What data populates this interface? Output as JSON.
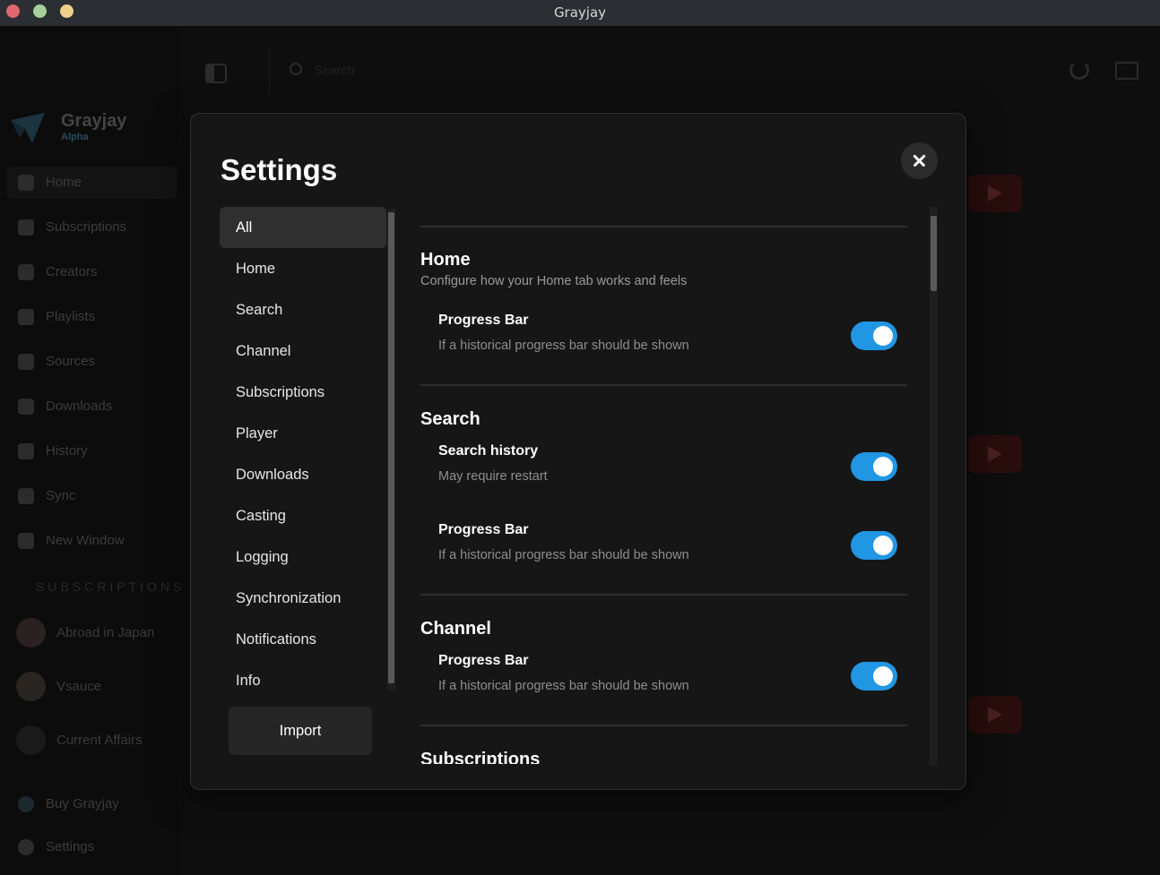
{
  "window": {
    "title": "Grayjay"
  },
  "background": {
    "brand": {
      "name": "Grayjay",
      "tag": "Alpha"
    },
    "search_placeholder": "Search",
    "sidebar": {
      "items": [
        {
          "label": "Home",
          "icon": "home-icon"
        },
        {
          "label": "Subscriptions",
          "icon": "subscriptions-icon"
        },
        {
          "label": "Creators",
          "icon": "creators-icon"
        },
        {
          "label": "Playlists",
          "icon": "playlists-icon"
        },
        {
          "label": "Sources",
          "icon": "sources-icon"
        },
        {
          "label": "Downloads",
          "icon": "downloads-icon"
        },
        {
          "label": "History",
          "icon": "history-icon"
        },
        {
          "label": "Sync",
          "icon": "sync-icon"
        },
        {
          "label": "New Window",
          "icon": "new-window-icon"
        }
      ],
      "subscriptions_heading": "SUBSCRIPTIONS",
      "subscriptions": [
        "Abroad in Japan",
        "Vsauce",
        "Current Affairs"
      ],
      "bottom": [
        {
          "label": "Buy Grayjay",
          "icon": "dollar-icon"
        },
        {
          "label": "Settings",
          "icon": "gear-icon"
        }
      ]
    }
  },
  "settings": {
    "title": "Settings",
    "nav": [
      "All",
      "Home",
      "Search",
      "Channel",
      "Subscriptions",
      "Player",
      "Downloads",
      "Casting",
      "Logging",
      "Synchronization",
      "Notifications",
      "Info"
    ],
    "active_nav": "All",
    "import_label": "Import",
    "sections": [
      {
        "title": "Home",
        "description": "Configure how your Home tab works and feels",
        "settings": [
          {
            "title": "Progress Bar",
            "description": "If a historical progress bar should be shown",
            "enabled": true
          }
        ]
      },
      {
        "title": "Search",
        "settings": [
          {
            "title": "Search history",
            "description": "May require restart",
            "enabled": true
          },
          {
            "title": "Progress Bar",
            "description": "If a historical progress bar should be shown",
            "enabled": true
          }
        ]
      },
      {
        "title": "Channel",
        "settings": [
          {
            "title": "Progress Bar",
            "description": "If a historical progress bar should be shown",
            "enabled": true
          }
        ]
      },
      {
        "title": "Subscriptions"
      }
    ]
  },
  "colors": {
    "accent": "#2196e3",
    "modal_bg": "#161616",
    "active_nav_bg": "#2f2f2f"
  }
}
